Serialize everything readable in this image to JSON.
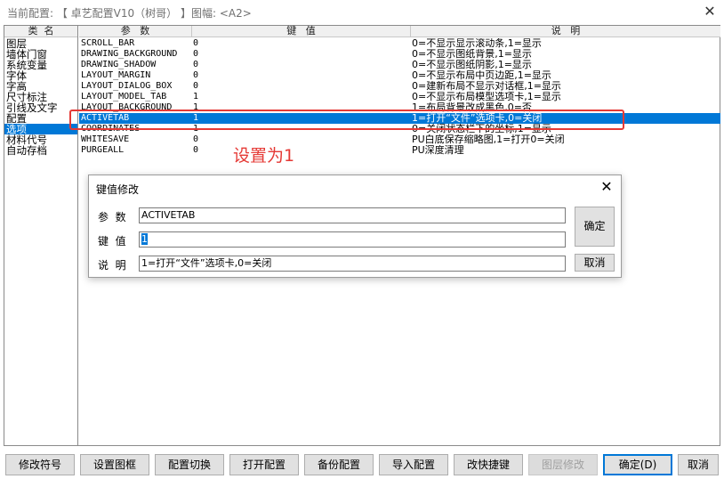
{
  "window": {
    "title": "当前配置: 【 卓艺配置V10（树哥） 】图幅: <A2>",
    "close_glyph": "✕"
  },
  "categories": {
    "header": "类  名",
    "items": [
      "图层",
      "墙体门窗",
      "系统变量",
      "字体",
      "字高",
      "尺寸标注",
      "引线及文字",
      "配置",
      "选项",
      "材料代号",
      "自动存档"
    ],
    "selected_index": 8
  },
  "grid": {
    "headers": [
      "参   数",
      "键   值",
      "说   明"
    ],
    "rows": [
      {
        "param": "SCROLL_BAR",
        "value": "0",
        "desc": "0=不显示显示滚动条,1=显示"
      },
      {
        "param": "DRAWING_BACKGROUND",
        "value": "0",
        "desc": "0=不显示图纸背景,1=显示"
      },
      {
        "param": "DRAWING_SHADOW",
        "value": "0",
        "desc": "0=不显示图纸阴影,1=显示"
      },
      {
        "param": "LAYOUT_MARGIN",
        "value": "0",
        "desc": "0=不显示布局中页边距,1=显示"
      },
      {
        "param": "LAYOUT_DIALOG_BOX",
        "value": "0",
        "desc": "0=建新布局不显示对话框,1=显示"
      },
      {
        "param": "LAYOUT_MODEL_TAB",
        "value": "1",
        "desc": "0=不显示布局模型选项卡,1=显示"
      },
      {
        "param": "LAYOUT_BACKGROUND",
        "value": "1",
        "desc": "1=布局背景改成黑色,0=否"
      },
      {
        "param": "ACTIVETAB",
        "value": "1",
        "desc": "1=打开“文件”选项卡,0=关闭"
      },
      {
        "param": "COORDINATES",
        "value": "1",
        "desc": "0=关闭状态栏下的坐标,1=显示"
      },
      {
        "param": "WHITESAVE",
        "value": "0",
        "desc": "PU白底保存缩略图,1=打开0=关闭"
      },
      {
        "param": "PURGEALL",
        "value": "0",
        "desc": "PU深度清理"
      }
    ],
    "selected_index": 7
  },
  "annotation": {
    "text": "设置为1",
    "color": "#e53935"
  },
  "dialog": {
    "title": "键值修改",
    "close_glyph": "✕",
    "param_label": "参  数",
    "param_value": "ACTIVETAB",
    "value_label": "键  值",
    "value_value": "1",
    "desc_label": "说  明",
    "desc_value": "1=打开“文件”选项卡,0=关闭",
    "ok_label": "确定",
    "cancel_label": "取消"
  },
  "toolbar": {
    "buttons": [
      {
        "label": "修改符号",
        "enabled": true
      },
      {
        "label": "设置图框",
        "enabled": true
      },
      {
        "label": "配置切换",
        "enabled": true
      },
      {
        "label": "打开配置",
        "enabled": true
      },
      {
        "label": "备份配置",
        "enabled": true
      },
      {
        "label": "导入配置",
        "enabled": true
      },
      {
        "label": "改快捷键",
        "enabled": true
      },
      {
        "label": "图层修改",
        "enabled": false
      },
      {
        "label": "确定(D)",
        "enabled": true,
        "default": true
      },
      {
        "label": "取消",
        "enabled": true
      }
    ]
  },
  "colors": {
    "selection": "#0078d7",
    "highlight_box": "#e53935"
  }
}
